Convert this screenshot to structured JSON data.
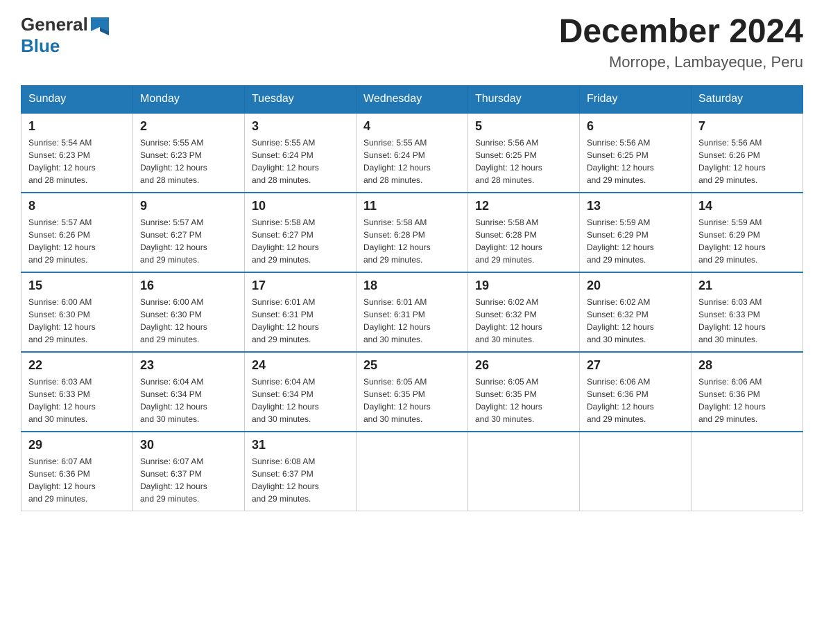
{
  "logo": {
    "text_general": "General",
    "text_blue": "Blue"
  },
  "header": {
    "month_year": "December 2024",
    "location": "Morrope, Lambayeque, Peru"
  },
  "weekdays": [
    "Sunday",
    "Monday",
    "Tuesday",
    "Wednesday",
    "Thursday",
    "Friday",
    "Saturday"
  ],
  "weeks": [
    [
      {
        "day": "1",
        "sunrise": "5:54 AM",
        "sunset": "6:23 PM",
        "daylight": "12 hours and 28 minutes."
      },
      {
        "day": "2",
        "sunrise": "5:55 AM",
        "sunset": "6:23 PM",
        "daylight": "12 hours and 28 minutes."
      },
      {
        "day": "3",
        "sunrise": "5:55 AM",
        "sunset": "6:24 PM",
        "daylight": "12 hours and 28 minutes."
      },
      {
        "day": "4",
        "sunrise": "5:55 AM",
        "sunset": "6:24 PM",
        "daylight": "12 hours and 28 minutes."
      },
      {
        "day": "5",
        "sunrise": "5:56 AM",
        "sunset": "6:25 PM",
        "daylight": "12 hours and 28 minutes."
      },
      {
        "day": "6",
        "sunrise": "5:56 AM",
        "sunset": "6:25 PM",
        "daylight": "12 hours and 29 minutes."
      },
      {
        "day": "7",
        "sunrise": "5:56 AM",
        "sunset": "6:26 PM",
        "daylight": "12 hours and 29 minutes."
      }
    ],
    [
      {
        "day": "8",
        "sunrise": "5:57 AM",
        "sunset": "6:26 PM",
        "daylight": "12 hours and 29 minutes."
      },
      {
        "day": "9",
        "sunrise": "5:57 AM",
        "sunset": "6:27 PM",
        "daylight": "12 hours and 29 minutes."
      },
      {
        "day": "10",
        "sunrise": "5:58 AM",
        "sunset": "6:27 PM",
        "daylight": "12 hours and 29 minutes."
      },
      {
        "day": "11",
        "sunrise": "5:58 AM",
        "sunset": "6:28 PM",
        "daylight": "12 hours and 29 minutes."
      },
      {
        "day": "12",
        "sunrise": "5:58 AM",
        "sunset": "6:28 PM",
        "daylight": "12 hours and 29 minutes."
      },
      {
        "day": "13",
        "sunrise": "5:59 AM",
        "sunset": "6:29 PM",
        "daylight": "12 hours and 29 minutes."
      },
      {
        "day": "14",
        "sunrise": "5:59 AM",
        "sunset": "6:29 PM",
        "daylight": "12 hours and 29 minutes."
      }
    ],
    [
      {
        "day": "15",
        "sunrise": "6:00 AM",
        "sunset": "6:30 PM",
        "daylight": "12 hours and 29 minutes."
      },
      {
        "day": "16",
        "sunrise": "6:00 AM",
        "sunset": "6:30 PM",
        "daylight": "12 hours and 29 minutes."
      },
      {
        "day": "17",
        "sunrise": "6:01 AM",
        "sunset": "6:31 PM",
        "daylight": "12 hours and 29 minutes."
      },
      {
        "day": "18",
        "sunrise": "6:01 AM",
        "sunset": "6:31 PM",
        "daylight": "12 hours and 30 minutes."
      },
      {
        "day": "19",
        "sunrise": "6:02 AM",
        "sunset": "6:32 PM",
        "daylight": "12 hours and 30 minutes."
      },
      {
        "day": "20",
        "sunrise": "6:02 AM",
        "sunset": "6:32 PM",
        "daylight": "12 hours and 30 minutes."
      },
      {
        "day": "21",
        "sunrise": "6:03 AM",
        "sunset": "6:33 PM",
        "daylight": "12 hours and 30 minutes."
      }
    ],
    [
      {
        "day": "22",
        "sunrise": "6:03 AM",
        "sunset": "6:33 PM",
        "daylight": "12 hours and 30 minutes."
      },
      {
        "day": "23",
        "sunrise": "6:04 AM",
        "sunset": "6:34 PM",
        "daylight": "12 hours and 30 minutes."
      },
      {
        "day": "24",
        "sunrise": "6:04 AM",
        "sunset": "6:34 PM",
        "daylight": "12 hours and 30 minutes."
      },
      {
        "day": "25",
        "sunrise": "6:05 AM",
        "sunset": "6:35 PM",
        "daylight": "12 hours and 30 minutes."
      },
      {
        "day": "26",
        "sunrise": "6:05 AM",
        "sunset": "6:35 PM",
        "daylight": "12 hours and 30 minutes."
      },
      {
        "day": "27",
        "sunrise": "6:06 AM",
        "sunset": "6:36 PM",
        "daylight": "12 hours and 29 minutes."
      },
      {
        "day": "28",
        "sunrise": "6:06 AM",
        "sunset": "6:36 PM",
        "daylight": "12 hours and 29 minutes."
      }
    ],
    [
      {
        "day": "29",
        "sunrise": "6:07 AM",
        "sunset": "6:36 PM",
        "daylight": "12 hours and 29 minutes."
      },
      {
        "day": "30",
        "sunrise": "6:07 AM",
        "sunset": "6:37 PM",
        "daylight": "12 hours and 29 minutes."
      },
      {
        "day": "31",
        "sunrise": "6:08 AM",
        "sunset": "6:37 PM",
        "daylight": "12 hours and 29 minutes."
      },
      null,
      null,
      null,
      null
    ]
  ],
  "labels": {
    "sunrise": "Sunrise:",
    "sunset": "Sunset:",
    "daylight": "Daylight:"
  }
}
